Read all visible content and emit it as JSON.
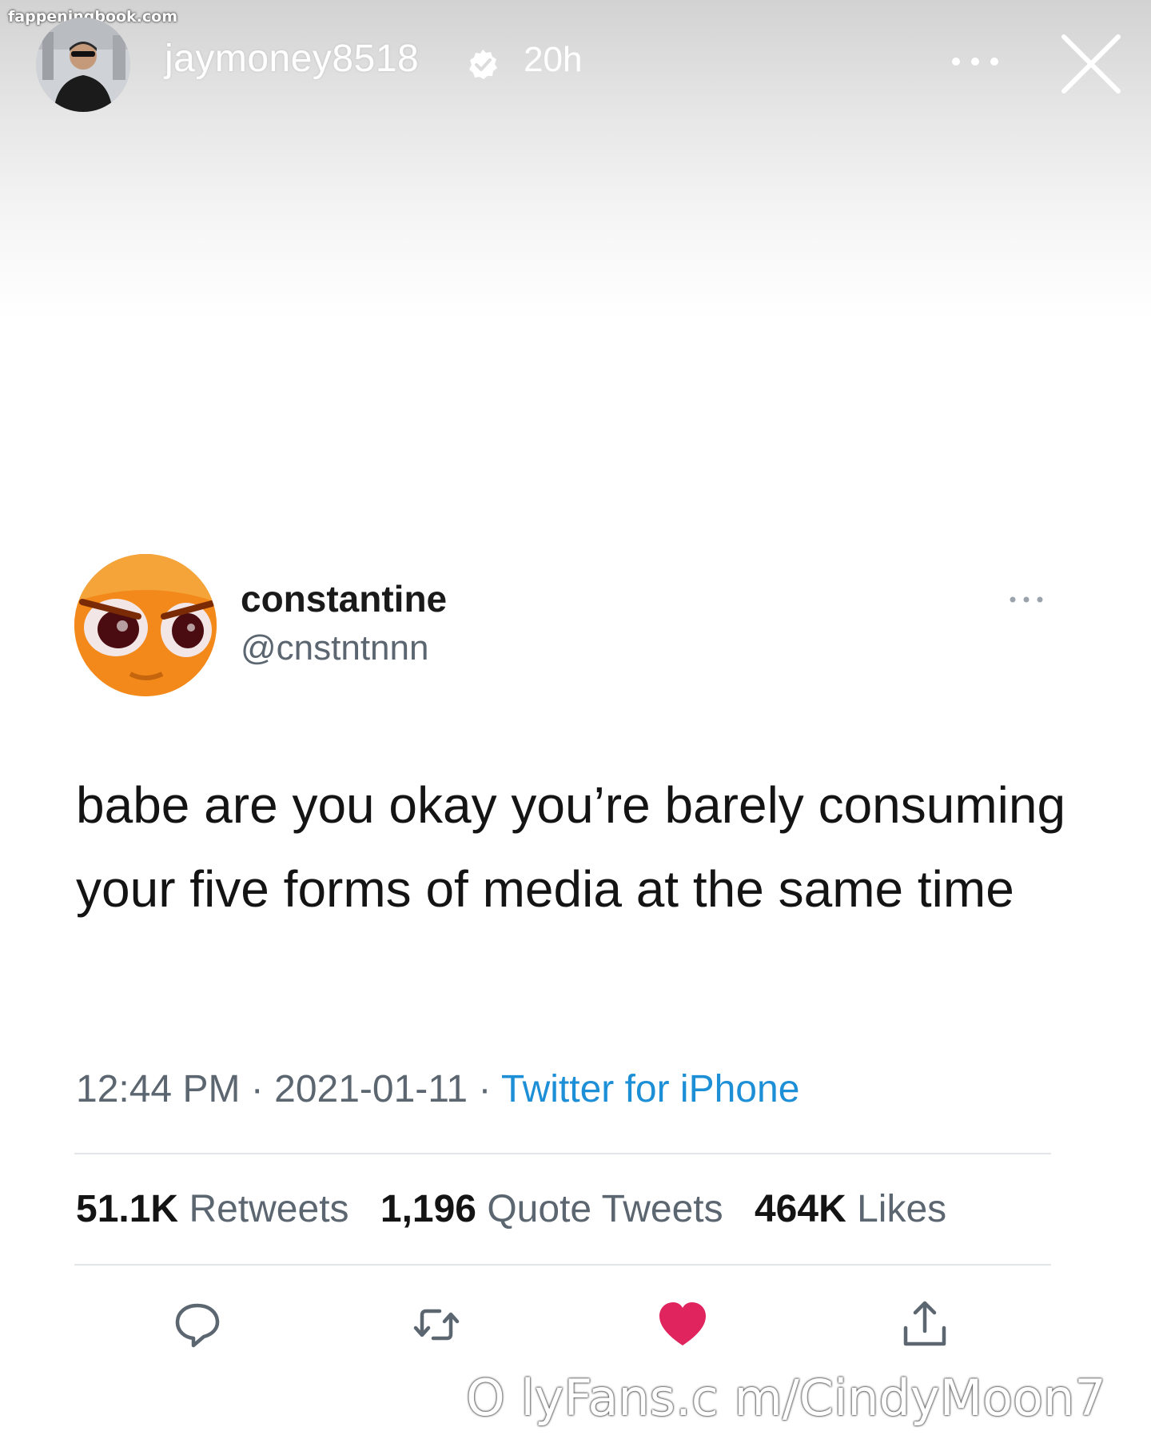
{
  "watermark_top": "fappeningbook.com",
  "story": {
    "username": "jaymoney8518",
    "time": "20h",
    "verified_icon": "verified-badge-icon",
    "more_icon": "more-horizontal-icon",
    "close_icon": "close-icon"
  },
  "tweet": {
    "display_name": "constantine",
    "handle": "@cnstntnnn",
    "text": "babe are you okay you’re barely consuming your five forms of media at the same time",
    "time": "12:44 PM",
    "separator": "·",
    "date": "2021-01-11",
    "source": "Twitter for iPhone",
    "source_color": "#1d8fd6",
    "stats": [
      {
        "num": "51.1K",
        "label": "Retweets"
      },
      {
        "num": "1,196",
        "label": "Quote Tweets"
      },
      {
        "num": "464K",
        "label": "Likes"
      }
    ],
    "actions": [
      {
        "icon": "reply-icon"
      },
      {
        "icon": "retweet-icon"
      },
      {
        "icon": "heart-icon",
        "color": "#e0245e"
      },
      {
        "icon": "share-icon"
      }
    ]
  },
  "watermark_bottom": "O lyFans.c m/CindyMoon7"
}
